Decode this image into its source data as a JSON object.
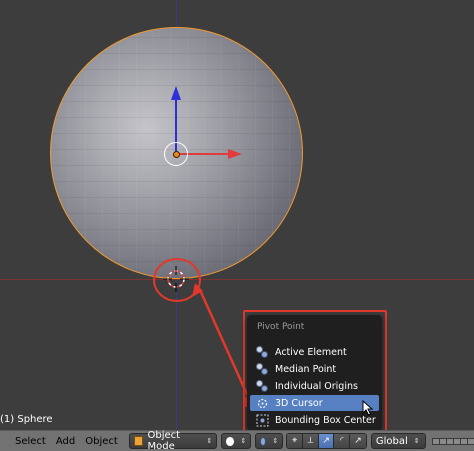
{
  "viewport": {
    "object_label": "(1) Sphere"
  },
  "pivot_menu": {
    "title": "Pivot Point",
    "items": [
      {
        "label": "Active Element",
        "icon": "active-element-icon"
      },
      {
        "label": "Median Point",
        "icon": "median-point-icon"
      },
      {
        "label": "Individual Origins",
        "icon": "individual-origins-icon"
      },
      {
        "label": "3D Cursor",
        "icon": "3d-cursor-icon",
        "active": true
      },
      {
        "label": "Bounding Box Center",
        "icon": "bounding-box-center-icon"
      }
    ]
  },
  "header": {
    "menus": [
      "Select",
      "Add",
      "Object"
    ],
    "mode": "Object Mode",
    "orientation": "Global"
  },
  "colors": {
    "selection_outline": "#f29a2e",
    "menu_highlight": "#5680c2",
    "annotation_red": "#e0392b",
    "x_axis": "#e23b3b",
    "z_axis": "#2f2fd8"
  }
}
